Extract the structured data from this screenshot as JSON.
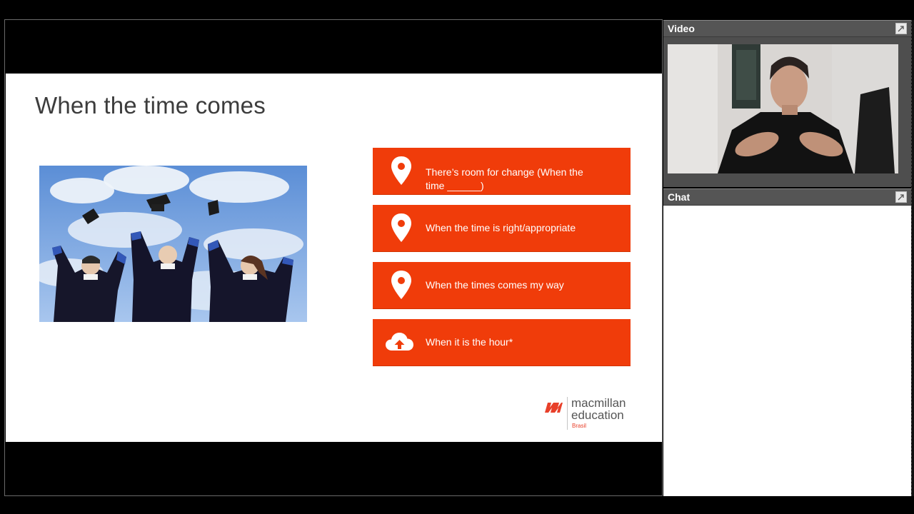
{
  "slide": {
    "title": "When the time comes",
    "cards": [
      {
        "icon": "map-pin-icon",
        "text": "There’s room for change (When the time ______)"
      },
      {
        "icon": "map-pin-icon",
        "text": "When the time is right/appropriate"
      },
      {
        "icon": "map-pin-icon",
        "text": "When the times comes my way"
      },
      {
        "icon": "cloud-upload-icon",
        "text": "When it is the hour*"
      }
    ],
    "logo": {
      "line1": "macmillan",
      "line2": "education",
      "line3": "Brasil"
    },
    "colors": {
      "card": "#f03c0a",
      "title": "#3c3c3c",
      "logo_accent": "#e8402a"
    }
  },
  "panels": {
    "video": {
      "title": "Video",
      "button_icon": "expand-icon"
    },
    "chat": {
      "title": "Chat",
      "button_icon": "expand-icon"
    }
  }
}
